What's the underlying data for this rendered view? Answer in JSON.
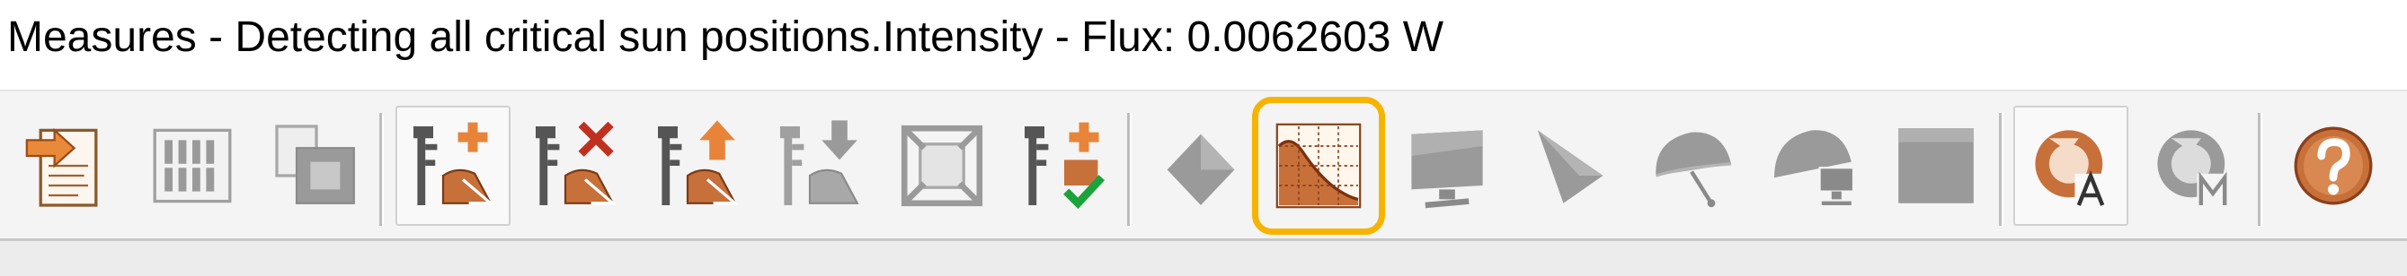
{
  "window": {
    "title": "Measures - Detecting all critical sun positions.Intensity - Flux: 0.0062603 W"
  },
  "toolbar": {
    "buttons": [
      {
        "name": "import-report-button",
        "icon": "import-report-icon",
        "enabled": true
      },
      {
        "name": "grid-view-button",
        "icon": "grid-icon",
        "enabled": false
      },
      {
        "name": "copy-button",
        "icon": "copy-icon",
        "enabled": false
      },
      {
        "name": "add-measure-button",
        "icon": "add-measure-icon",
        "enabled": true,
        "pressed": true
      },
      {
        "name": "delete-measure-button",
        "icon": "delete-measure-icon",
        "enabled": true
      },
      {
        "name": "export-measure-button",
        "icon": "export-measure-icon",
        "enabled": true
      },
      {
        "name": "import-measure-button",
        "icon": "import-measure-icon",
        "enabled": false
      },
      {
        "name": "fit-view-button",
        "icon": "fit-view-icon",
        "enabled": false
      },
      {
        "name": "validate-measure-button",
        "icon": "validate-measure-icon",
        "enabled": true
      },
      {
        "name": "point-measure-button",
        "icon": "diamond-icon",
        "enabled": false
      },
      {
        "name": "surface-measure-button",
        "icon": "surface-chart-icon",
        "enabled": true,
        "highlighted": true
      },
      {
        "name": "screen-measure-button",
        "icon": "screen-icon",
        "enabled": false
      },
      {
        "name": "cone-measure-button",
        "icon": "cone-icon",
        "enabled": false
      },
      {
        "name": "sphere-measure-button",
        "icon": "sphere-icon",
        "enabled": false
      },
      {
        "name": "sphere-screen-measure-button",
        "icon": "sphere-screen-icon",
        "enabled": false
      },
      {
        "name": "square-measure-button",
        "icon": "square-icon",
        "enabled": false
      },
      {
        "name": "auto-refresh-button",
        "icon": "refresh-auto-icon",
        "enabled": true,
        "pressed": true
      },
      {
        "name": "manual-refresh-button",
        "icon": "refresh-manual-icon",
        "enabled": false
      },
      {
        "name": "help-button",
        "icon": "help-icon",
        "enabled": true
      }
    ]
  },
  "colors": {
    "accent": "#c8703a",
    "accent_dark": "#8b3f1a",
    "disabled": "#9a9a9a",
    "highlight": "#f6b400",
    "check": "#1aa33a",
    "delete": "#c03020"
  }
}
